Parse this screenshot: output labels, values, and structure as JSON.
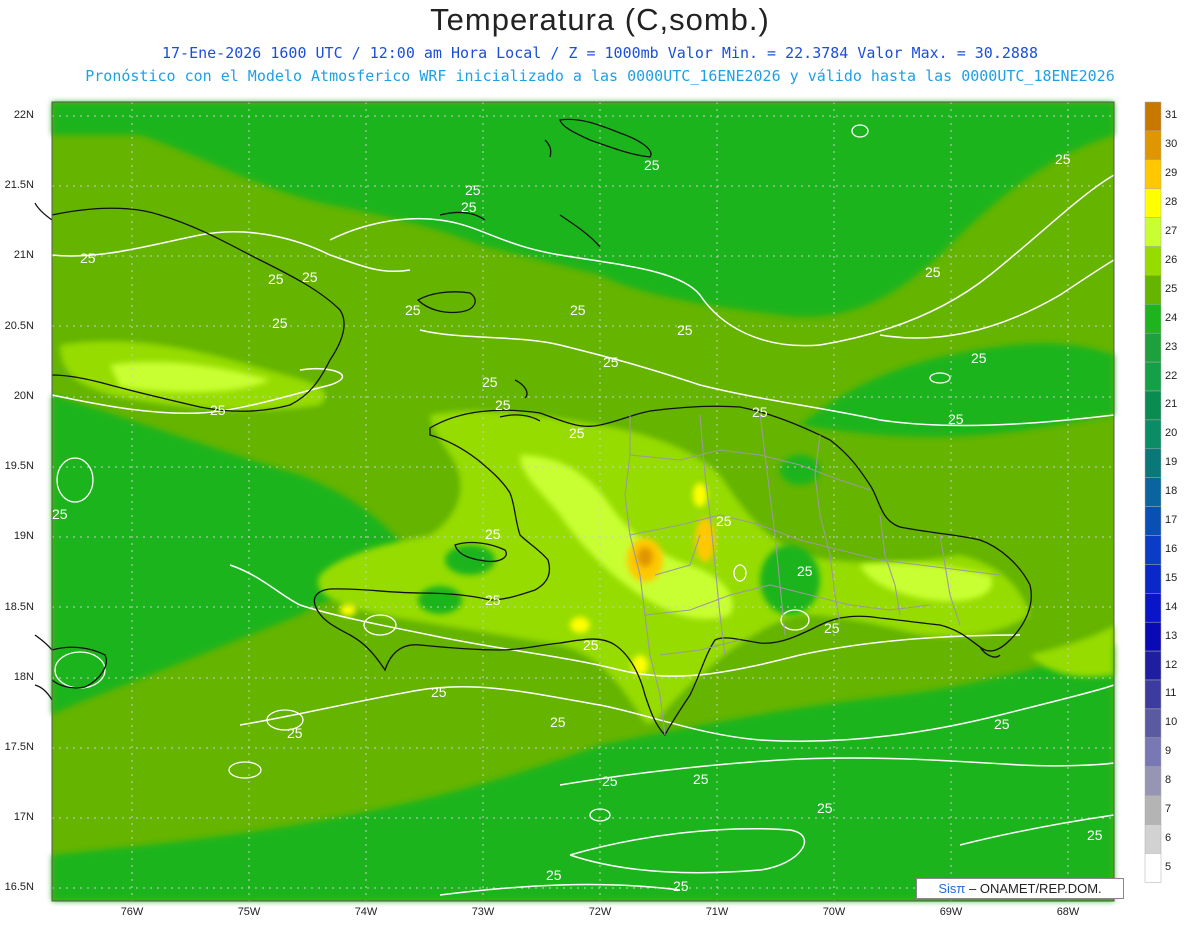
{
  "header": {
    "title": "Temperatura (C,somb.)",
    "subtitle": "17-Ene-2026 1600 UTC / 12:00 am Hora Local / Z = 1000mb   Valor Min. = 22.3784  Valor Max. = 30.2888",
    "model_info": "Pronóstico con el Modelo Atmosferico WRF inicializado a las 0000UTC_16ENE2026 y válido hasta las  0000UTC_18ENE2026"
  },
  "axes": {
    "lat_labels": [
      "22N",
      "21.5N",
      "21N",
      "20.5N",
      "20N",
      "19.5N",
      "19N",
      "18.5N",
      "18N",
      "17.5N",
      "17N",
      "16.5N"
    ],
    "lon_labels": [
      "76W",
      "75W",
      "74W",
      "73W",
      "72W",
      "71W",
      "70W",
      "69W",
      "68W"
    ]
  },
  "colorbar": {
    "labels": [
      "31",
      "30",
      "29",
      "28",
      "27",
      "26",
      "25",
      "24",
      "23",
      "22",
      "21",
      "20",
      "19",
      "18",
      "17",
      "16",
      "15",
      "14",
      "13",
      "12",
      "11",
      "10",
      "9",
      "8",
      "7",
      "6",
      "5"
    ],
    "colors": [
      "#c87800",
      "#e09600",
      "#ffc800",
      "#ffff00",
      "#c8ff32",
      "#96dc00",
      "#64b400",
      "#1eb41e",
      "#1ea03c",
      "#14a046",
      "#0a8c50",
      "#0a8c64",
      "#0a7878",
      "#0a64a0",
      "#0a50b4",
      "#0a3cc8",
      "#0a28c8",
      "#0a14c8",
      "#0a0ab4",
      "#1e1ea0",
      "#3c3ca0",
      "#5a5aa0",
      "#7878b4",
      "#9696b4",
      "#b4b4b4",
      "#d2d2d2",
      "#ffffff"
    ]
  },
  "contours": {
    "label": "25"
  },
  "credit": {
    "sis": "Sisπ",
    "text": "– ONAMET/REP.DOM."
  }
}
